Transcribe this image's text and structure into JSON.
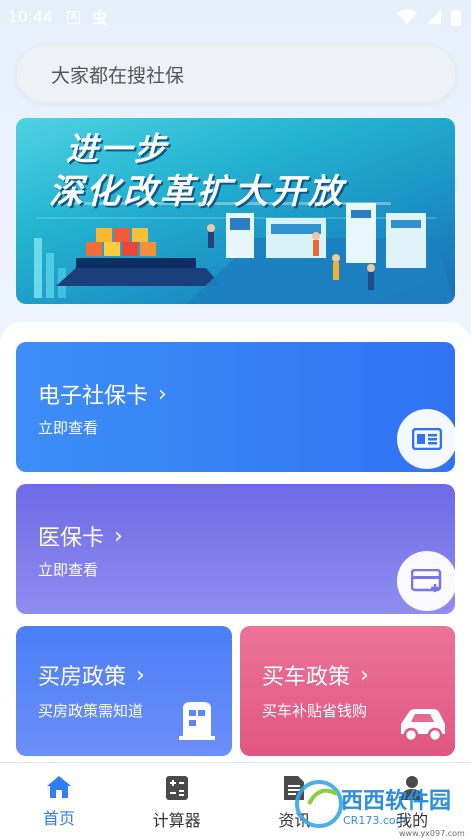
{
  "status_bar": {
    "time": "10:44",
    "indicator_a": "A",
    "bug_glyph": "虫"
  },
  "search": {
    "placeholder": "大家都在搜社保"
  },
  "banner": {
    "line1": "进一步",
    "line2": "深化改革扩大开放"
  },
  "cards": {
    "social_card": {
      "title": "电子社保卡",
      "subtitle": "立即查看",
      "chevron": "›",
      "icon": "id-card-icon",
      "color_start": "#3a8af6",
      "color_end": "#2f6cf2"
    },
    "medical_card": {
      "title": "医保卡",
      "subtitle": "立即查看",
      "chevron": "›",
      "icon": "card-plus-icon",
      "color_start": "#7b78ea",
      "color_end": "#8e8cf0"
    },
    "house_policy": {
      "title": "买房政策",
      "subtitle": "买房政策需知道",
      "chevron": "›",
      "icon": "building-icon",
      "color_start": "#4f86f7",
      "color_end": "#6b8cf8"
    },
    "car_policy": {
      "title": "买车政策",
      "subtitle": "买车补贴省钱购",
      "chevron": "›",
      "icon": "car-icon",
      "color_start": "#ea6f95",
      "color_end": "#e05882"
    }
  },
  "bottom_nav": {
    "items": [
      {
        "label": "首页",
        "icon": "home-icon",
        "active": true
      },
      {
        "label": "计算器",
        "icon": "calculator-icon",
        "active": false
      },
      {
        "label": "资讯",
        "icon": "news-icon",
        "active": false
      },
      {
        "label": "我的",
        "icon": "user-icon",
        "active": false
      }
    ]
  },
  "watermark": {
    "brand": "西西软件园",
    "url": "CR173.com",
    "url2": "www.yx097.com"
  },
  "colors": {
    "accent": "#2f7ef5"
  }
}
